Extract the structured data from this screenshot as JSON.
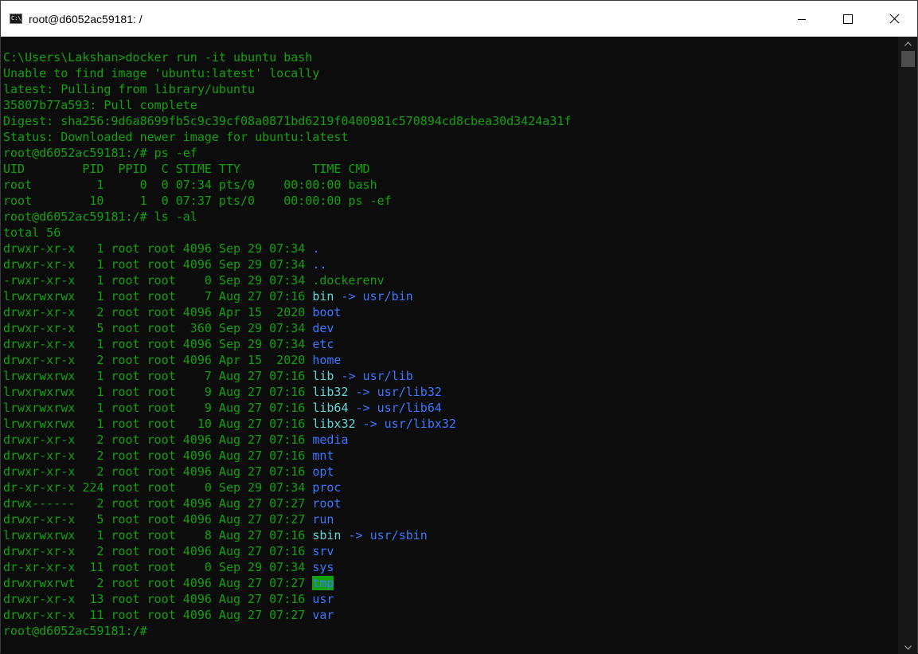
{
  "window": {
    "title": "root@d6052ac59181: /",
    "icon_text": "C:\\_"
  },
  "terminal": {
    "lines": [
      "C:\\Users\\Lakshan>docker run -it ubuntu bash",
      "Unable to find image 'ubuntu:latest' locally",
      "latest: Pulling from library/ubuntu",
      "35807b77a593: Pull complete",
      "Digest: sha256:9d6a8699fb5c9c39cf08a0871bd6219f0400981c570894cd8cbea30d3424a31f",
      "Status: Downloaded newer image for ubuntu:latest",
      "root@d6052ac59181:/# ps -ef",
      "UID        PID  PPID  C STIME TTY          TIME CMD",
      "root         1     0  0 07:34 pts/0    00:00:00 bash",
      "root        10     1  0 07:37 pts/0    00:00:00 ps -ef",
      "root@d6052ac59181:/# ls -al",
      "total 56"
    ],
    "listing": [
      {
        "meta": "drwxr-xr-x   1 root root 4096 Sep 29 07:34 ",
        "name": ".",
        "type": "dir"
      },
      {
        "meta": "drwxr-xr-x   1 root root 4096 Sep 29 07:34 ",
        "name": "..",
        "type": "dir"
      },
      {
        "meta": "-rwxr-xr-x   1 root root    0 Sep 29 07:34 ",
        "name": ".dockerenv",
        "type": "file"
      },
      {
        "meta": "lrwxrwxrwx   1 root root    7 Aug 27 07:16 ",
        "name": "bin",
        "type": "link",
        "arrow": " -> ",
        "target": "usr/bin"
      },
      {
        "meta": "drwxr-xr-x   2 root root 4096 Apr 15  2020 ",
        "name": "boot",
        "type": "dir"
      },
      {
        "meta": "drwxr-xr-x   5 root root  360 Sep 29 07:34 ",
        "name": "dev",
        "type": "dir"
      },
      {
        "meta": "drwxr-xr-x   1 root root 4096 Sep 29 07:34 ",
        "name": "etc",
        "type": "dir"
      },
      {
        "meta": "drwxr-xr-x   2 root root 4096 Apr 15  2020 ",
        "name": "home",
        "type": "dir"
      },
      {
        "meta": "lrwxrwxrwx   1 root root    7 Aug 27 07:16 ",
        "name": "lib",
        "type": "link",
        "arrow": " -> ",
        "target": "usr/lib"
      },
      {
        "meta": "lrwxrwxrwx   1 root root    9 Aug 27 07:16 ",
        "name": "lib32",
        "type": "link",
        "arrow": " -> ",
        "target": "usr/lib32"
      },
      {
        "meta": "lrwxrwxrwx   1 root root    9 Aug 27 07:16 ",
        "name": "lib64",
        "type": "link",
        "arrow": " -> ",
        "target": "usr/lib64"
      },
      {
        "meta": "lrwxrwxrwx   1 root root   10 Aug 27 07:16 ",
        "name": "libx32",
        "type": "link",
        "arrow": " -> ",
        "target": "usr/libx32"
      },
      {
        "meta": "drwxr-xr-x   2 root root 4096 Aug 27 07:16 ",
        "name": "media",
        "type": "dir"
      },
      {
        "meta": "drwxr-xr-x   2 root root 4096 Aug 27 07:16 ",
        "name": "mnt",
        "type": "dir"
      },
      {
        "meta": "drwxr-xr-x   2 root root 4096 Aug 27 07:16 ",
        "name": "opt",
        "type": "dir"
      },
      {
        "meta": "dr-xr-xr-x 224 root root    0 Sep 29 07:34 ",
        "name": "proc",
        "type": "dir"
      },
      {
        "meta": "drwx------   2 root root 4096 Aug 27 07:27 ",
        "name": "root",
        "type": "dir"
      },
      {
        "meta": "drwxr-xr-x   5 root root 4096 Aug 27 07:27 ",
        "name": "run",
        "type": "dir"
      },
      {
        "meta": "lrwxrwxrwx   1 root root    8 Aug 27 07:16 ",
        "name": "sbin",
        "type": "link",
        "arrow": " -> ",
        "target": "usr/sbin"
      },
      {
        "meta": "drwxr-xr-x   2 root root 4096 Aug 27 07:16 ",
        "name": "srv",
        "type": "dir"
      },
      {
        "meta": "dr-xr-xr-x  11 root root    0 Sep 29 07:34 ",
        "name": "sys",
        "type": "dir"
      },
      {
        "meta": "drwxrwxrwt   2 root root 4096 Aug 27 07:27 ",
        "name": "tmp",
        "type": "sticky"
      },
      {
        "meta": "drwxr-xr-x  13 root root 4096 Aug 27 07:16 ",
        "name": "usr",
        "type": "dir"
      },
      {
        "meta": "drwxr-xr-x  11 root root 4096 Aug 27 07:27 ",
        "name": "var",
        "type": "dir"
      }
    ],
    "prompt": "root@d6052ac59181:/#"
  },
  "colors": {
    "text": "#13a10e",
    "directory": "#3b78ff",
    "symlink": "#61d6d6",
    "sticky_bg": "#13a10e",
    "background": "#0c0c0c"
  }
}
